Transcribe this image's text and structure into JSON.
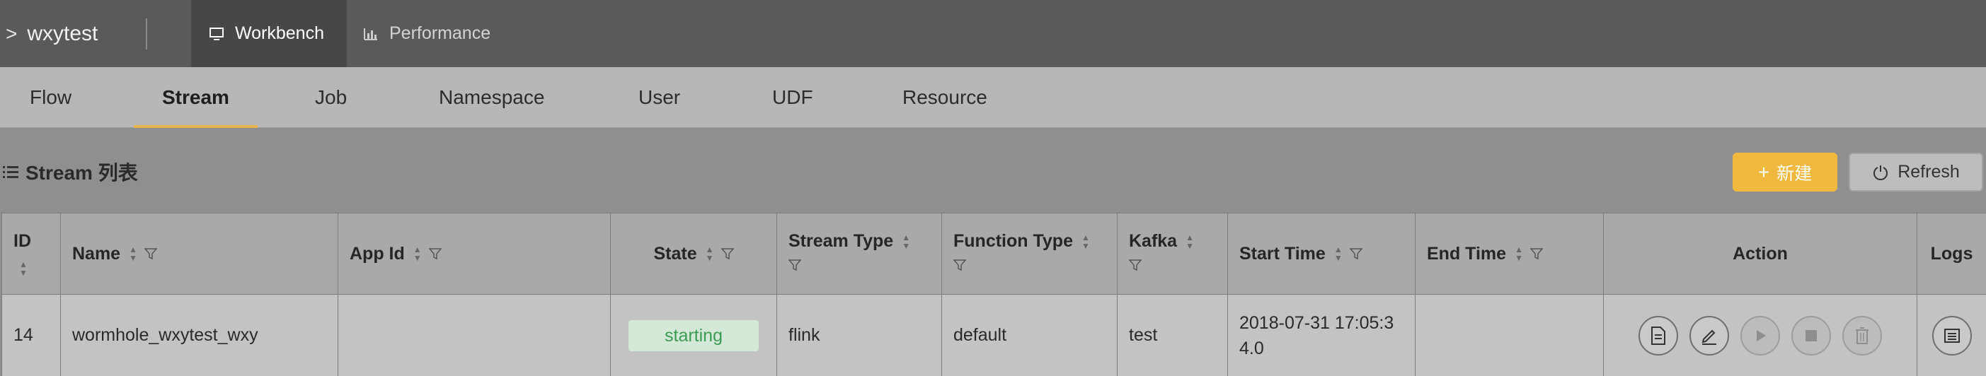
{
  "header": {
    "project_name": "wxytest",
    "tabs": [
      {
        "label": "Workbench",
        "icon": "monitor-icon",
        "active": true
      },
      {
        "label": "Performance",
        "icon": "bar-chart-icon",
        "active": false
      }
    ]
  },
  "subnav": {
    "items": [
      {
        "label": "Flow"
      },
      {
        "label": "Stream",
        "active": true
      },
      {
        "label": "Job"
      },
      {
        "label": "Namespace"
      },
      {
        "label": "User"
      },
      {
        "label": "UDF"
      },
      {
        "label": "Resource"
      }
    ]
  },
  "section": {
    "title": "Stream 列表",
    "new_button": "新建",
    "refresh_button": "Refresh"
  },
  "table": {
    "columns": [
      "ID",
      "Name",
      "App Id",
      "State",
      "Stream Type",
      "Function Type",
      "Kafka",
      "Start Time",
      "End Time",
      "Action",
      "Logs"
    ],
    "rows": [
      {
        "id": "14",
        "name": "wormhole_wxytest_wxy",
        "app_id": "",
        "state": "starting",
        "stream_type": "flink",
        "function_type": "default",
        "kafka": "test",
        "start_time_line1": "2018-07-31 17:05:3",
        "start_time_line2": "4.0",
        "end_time": ""
      }
    ]
  },
  "colors": {
    "accent": "#f0b93e",
    "active_underline": "#e8b44c",
    "state_text": "#3c9c54",
    "state_bg": "#d3e8d7"
  }
}
